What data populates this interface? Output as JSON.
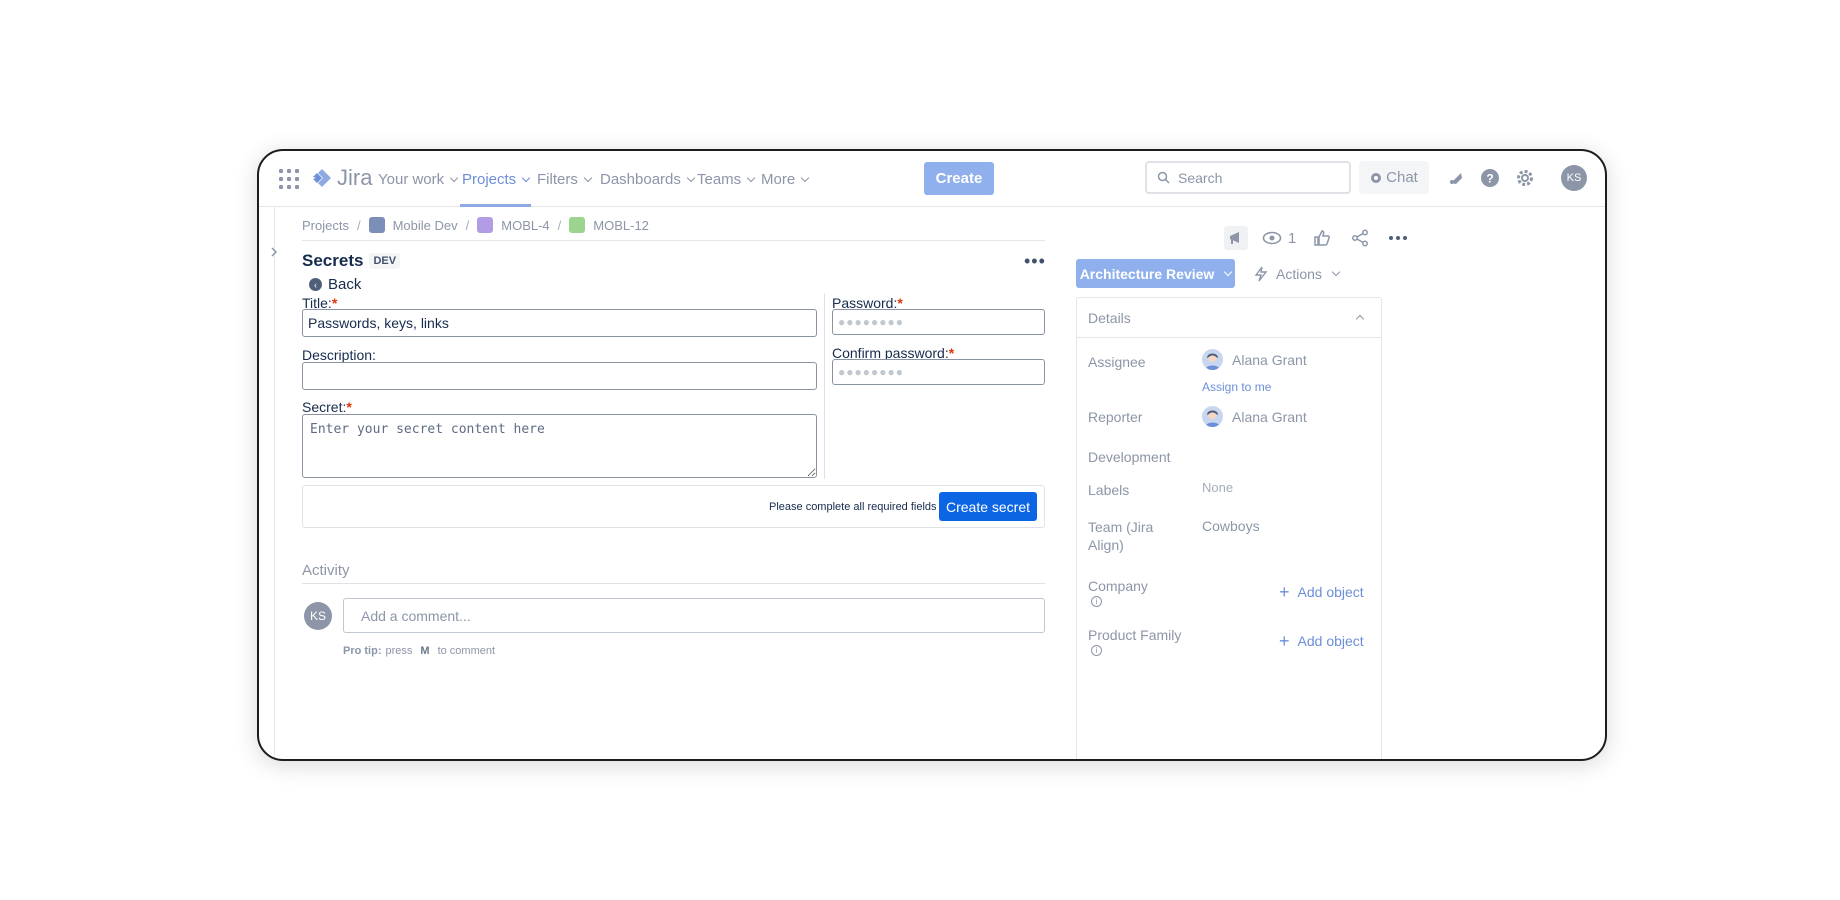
{
  "nav": {
    "logo": "Jira",
    "items": [
      "Your work",
      "Projects",
      "Filters",
      "Dashboards",
      "Teams",
      "More"
    ],
    "create_label": "Create",
    "search_placeholder": "Search",
    "chat_label": "Chat",
    "user_initials": "KS"
  },
  "breadcrumb": {
    "items": [
      "Projects",
      "Mobile Dev",
      "MOBL-4",
      "MOBL-12"
    ]
  },
  "page": {
    "title": "Secrets",
    "badge": "DEV",
    "more_label": "•••",
    "back_label": "Back"
  },
  "form": {
    "title_label": "Title:",
    "title_value": "Passwords, keys, links",
    "description_label": "Description:",
    "description_value": "",
    "secret_label": "Secret:",
    "secret_placeholder": "Enter your secret content here",
    "password_label": "Password:",
    "confirm_label": "Confirm password:",
    "password_mask": "●●●●●●●●",
    "required_mark": "*",
    "footer_note": "Please complete all required fields",
    "submit_label": "Create secret"
  },
  "activity": {
    "heading": "Activity",
    "avatar_initials": "KS",
    "comment_placeholder": "Add a comment...",
    "protip_prefix": "Pro tip:",
    "protip_press": "press",
    "protip_key": "M",
    "protip_suffix": "to comment"
  },
  "sidebar_right": {
    "watch_count": "1",
    "status_button": "Architecture Review",
    "actions_label": "Actions",
    "details": {
      "heading": "Details",
      "assignee_label": "Assignee",
      "assignee_name": "Alana Grant",
      "assign_to_me": "Assign to me",
      "reporter_label": "Reporter",
      "reporter_name": "Alana Grant",
      "development_label": "Development",
      "labels_label": "Labels",
      "labels_value": "None",
      "team_label": "Team (Jira Align)",
      "team_value": "Cowboys",
      "company_label": "Company",
      "product_family_label": "Product Family",
      "add_object": "Add object"
    }
  },
  "colors": {
    "primary": "#0c66e4",
    "status_button": "#8fb0ec",
    "required": "#de350b",
    "muted": "#8c96a8"
  }
}
